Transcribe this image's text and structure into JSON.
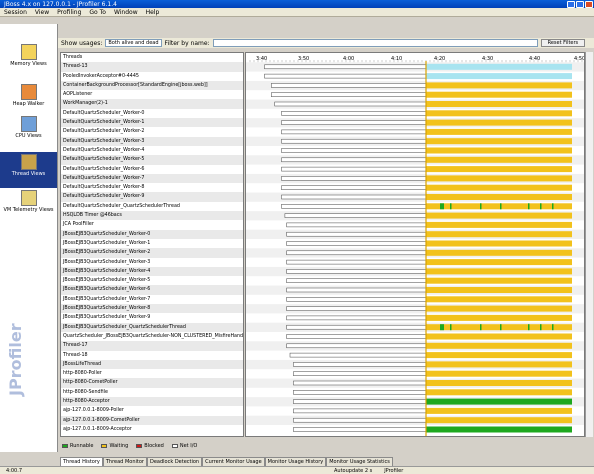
{
  "window": {
    "title": "JBoss 4.x on 127.0.0.1 - JProfiler 6.1.4"
  },
  "menu": [
    "Session",
    "View",
    "Profiling",
    "Go To",
    "Window",
    "Help"
  ],
  "sidebar": {
    "items": [
      {
        "label": "Memory Views",
        "icon": "memory-icon",
        "active": false
      },
      {
        "label": "Heap Walker",
        "icon": "heap-icon",
        "active": false
      },
      {
        "label": "CPU Views",
        "icon": "cpu-icon",
        "active": false
      },
      {
        "label": "Thread Views",
        "icon": "threads-icon",
        "active": true
      },
      {
        "label": "VM Telemetry Views",
        "icon": "telemetry-icon",
        "active": false
      }
    ],
    "watermark": "JProfiler"
  },
  "toolbar": {
    "show_label": "Show usages:",
    "show_value": "Both alive and dead",
    "filter_label": "Filter by name:",
    "reset_label": "Reset Filters"
  },
  "timeline": {
    "ticks": [
      "3:40",
      "3:50",
      "4:00",
      "4:10",
      "4:20",
      "4:30",
      "4:40",
      "4:50"
    ]
  },
  "threads": [
    {
      "name": "Threads",
      "start": 0.0,
      "profile": "header"
    },
    {
      "name": "Thread-13",
      "start": 0.05,
      "profile": "cyan"
    },
    {
      "name": "PooledInvokerAcceptor#0-4445",
      "start": 0.05,
      "profile": "cyan2"
    },
    {
      "name": "ContainerBackgroundProcessor[StandardEngine[jboss.web]]",
      "start": 0.09,
      "profile": "yellow"
    },
    {
      "name": "AOPListener",
      "start": 0.09,
      "profile": "yellow"
    },
    {
      "name": "WorkManager(2)-1",
      "start": 0.11,
      "profile": "yellow"
    },
    {
      "name": "DefaultQuartzScheduler_Worker-0",
      "start": 0.15,
      "profile": "yellow"
    },
    {
      "name": "DefaultQuartzScheduler_Worker-1",
      "start": 0.15,
      "profile": "yellow"
    },
    {
      "name": "DefaultQuartzScheduler_Worker-2",
      "start": 0.15,
      "profile": "yellow"
    },
    {
      "name": "DefaultQuartzScheduler_Worker-3",
      "start": 0.15,
      "profile": "yellow"
    },
    {
      "name": "DefaultQuartzScheduler_Worker-4",
      "start": 0.15,
      "profile": "yellow"
    },
    {
      "name": "DefaultQuartzScheduler_Worker-5",
      "start": 0.15,
      "profile": "yellow"
    },
    {
      "name": "DefaultQuartzScheduler_Worker-6",
      "start": 0.15,
      "profile": "yellow"
    },
    {
      "name": "DefaultQuartzScheduler_Worker-7",
      "start": 0.15,
      "profile": "yellow"
    },
    {
      "name": "DefaultQuartzScheduler_Worker-8",
      "start": 0.15,
      "profile": "yellow"
    },
    {
      "name": "DefaultQuartzScheduler_Worker-9",
      "start": 0.15,
      "profile": "yellow"
    },
    {
      "name": "DefaultQuartzScheduler_QuartzSchedulerThread",
      "start": 0.15,
      "profile": "greenbits"
    },
    {
      "name": "HSQLDB Timer @46bacs",
      "start": 0.17,
      "profile": "yellow"
    },
    {
      "name": "JCA PoolFiller",
      "start": 0.18,
      "profile": "yellow"
    },
    {
      "name": "JBossEJB3QuartzScheduler_Worker-0",
      "start": 0.18,
      "profile": "yellow"
    },
    {
      "name": "JBossEJB3QuartzScheduler_Worker-1",
      "start": 0.18,
      "profile": "yellow"
    },
    {
      "name": "JBossEJB3QuartzScheduler_Worker-2",
      "start": 0.18,
      "profile": "yellow"
    },
    {
      "name": "JBossEJB3QuartzScheduler_Worker-3",
      "start": 0.18,
      "profile": "yellow"
    },
    {
      "name": "JBossEJB3QuartzScheduler_Worker-4",
      "start": 0.18,
      "profile": "yellow"
    },
    {
      "name": "JBossEJB3QuartzScheduler_Worker-5",
      "start": 0.18,
      "profile": "yellow"
    },
    {
      "name": "JBossEJB3QuartzScheduler_Worker-6",
      "start": 0.18,
      "profile": "yellow"
    },
    {
      "name": "JBossEJB3QuartzScheduler_Worker-7",
      "start": 0.18,
      "profile": "yellow"
    },
    {
      "name": "JBossEJB3QuartzScheduler_Worker-8",
      "start": 0.18,
      "profile": "yellow"
    },
    {
      "name": "JBossEJB3QuartzScheduler_Worker-9",
      "start": 0.18,
      "profile": "yellow"
    },
    {
      "name": "JBossEJB3QuartzScheduler_QuartzSchedulerThread",
      "start": 0.18,
      "profile": "greenbits"
    },
    {
      "name": "QuartzScheduler_JBossEJB3QuartzScheduler-NON_CLUSTERED_MisfireHandler",
      "start": 0.18,
      "profile": "yellow"
    },
    {
      "name": "Thread-17",
      "start": 0.18,
      "profile": "yellow"
    },
    {
      "name": "Thread-18",
      "start": 0.2,
      "profile": "yellow"
    },
    {
      "name": "JBossLifeThread",
      "start": 0.22,
      "profile": "yellow"
    },
    {
      "name": "http-8080-Poller",
      "start": 0.22,
      "profile": "yellow"
    },
    {
      "name": "http-8080-CometPoller",
      "start": 0.22,
      "profile": "yellow"
    },
    {
      "name": "http-8080-Sendfile",
      "start": 0.22,
      "profile": "yellow"
    },
    {
      "name": "http-8080-Acceptor",
      "start": 0.22,
      "profile": "green"
    },
    {
      "name": "ajp-127.0.0.1-8009-Poller",
      "start": 0.22,
      "profile": "yellow"
    },
    {
      "name": "ajp-127.0.0.1-8009-CometPoller",
      "start": 0.22,
      "profile": "yellow"
    },
    {
      "name": "ajp-127.0.0.1-8009-Acceptor",
      "start": 0.22,
      "profile": "green"
    }
  ],
  "legend": [
    {
      "label": "Runnable",
      "color": "#1ea81e"
    },
    {
      "label": "Waiting",
      "color": "#f2c21c"
    },
    {
      "label": "Blocked",
      "color": "#d01818"
    },
    {
      "label": "Net I/O",
      "color": "#ffffff"
    }
  ],
  "colors": {
    "running": "#1ea81e",
    "waiting": "#f2c21c",
    "cyan": "#a8e4f0",
    "divider": "#d8a200"
  },
  "tabs": [
    {
      "label": "Thread History",
      "active": true
    },
    {
      "label": "Thread Monitor",
      "active": false
    },
    {
      "label": "Deadlock Detection",
      "active": false
    },
    {
      "label": "Current Monitor Usage",
      "active": false
    },
    {
      "label": "Monitor Usage History",
      "active": false
    },
    {
      "label": "Monitor Usage Statistics",
      "active": false
    }
  ],
  "status": {
    "left": "4:00.7",
    "mid": "Autoupdate 2 s",
    "right": "JProfiler"
  }
}
